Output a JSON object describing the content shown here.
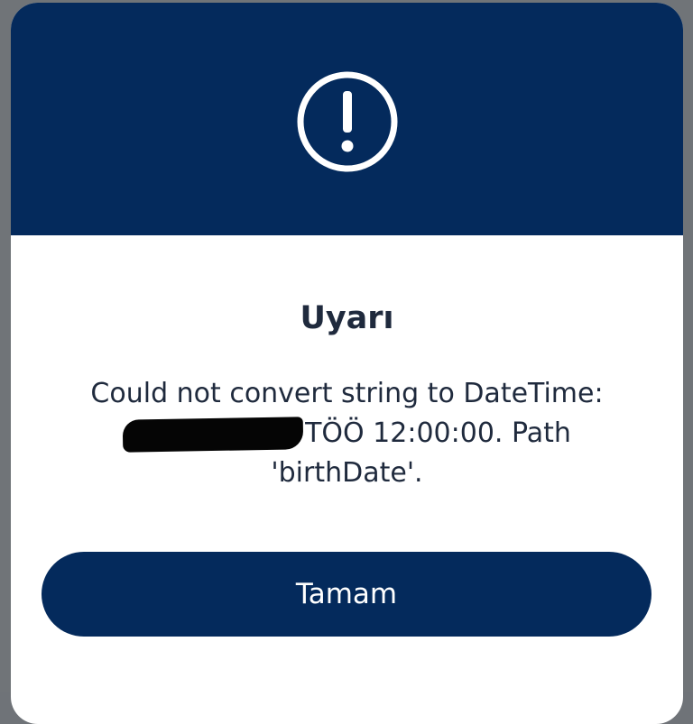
{
  "dialog": {
    "icon": "exclamation-circle-icon",
    "title": "Uyarı",
    "message_line1": "Could not convert string to DateTime:",
    "message_line2_suffix": "TÖÖ 12:00:00. Path",
    "message_line3": "'birthDate'.",
    "button_label": "Tamam"
  },
  "colors": {
    "header": "#042a5c",
    "button": "#042a5c",
    "text": "#1f2a3d",
    "backdrop": "#707478"
  }
}
